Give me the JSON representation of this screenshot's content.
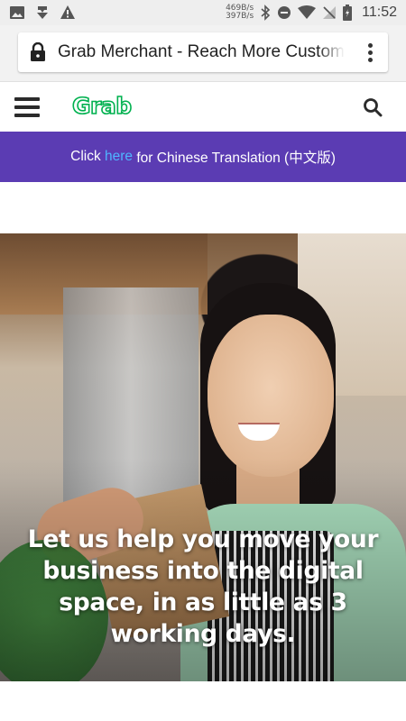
{
  "status_bar": {
    "net_up": "469B/s",
    "net_down": "397B/s",
    "time": "11:52",
    "icons": [
      "image-icon",
      "download-icon",
      "warning-icon",
      "bluetooth-icon",
      "do-not-disturb-icon",
      "wifi-icon",
      "no-signal-icon",
      "battery-icon"
    ]
  },
  "browser": {
    "url_text": "Grab Merchant - Reach More Customers",
    "icons": [
      "lock-icon",
      "more-options-icon"
    ]
  },
  "site_header": {
    "logo_text": "Grab",
    "icons": [
      "hamburger-menu-icon",
      "search-icon"
    ]
  },
  "banner": {
    "prefix": "Click ",
    "link": "here",
    "suffix": " for Chinese Translation (中文版)"
  },
  "hero": {
    "headline": "Let us help you move your business into the digital space, in as little as 3 working days."
  },
  "colors": {
    "brand_green": "#00b14f",
    "banner_purple": "#5b3cb3",
    "link_blue": "#4fb5ff"
  }
}
